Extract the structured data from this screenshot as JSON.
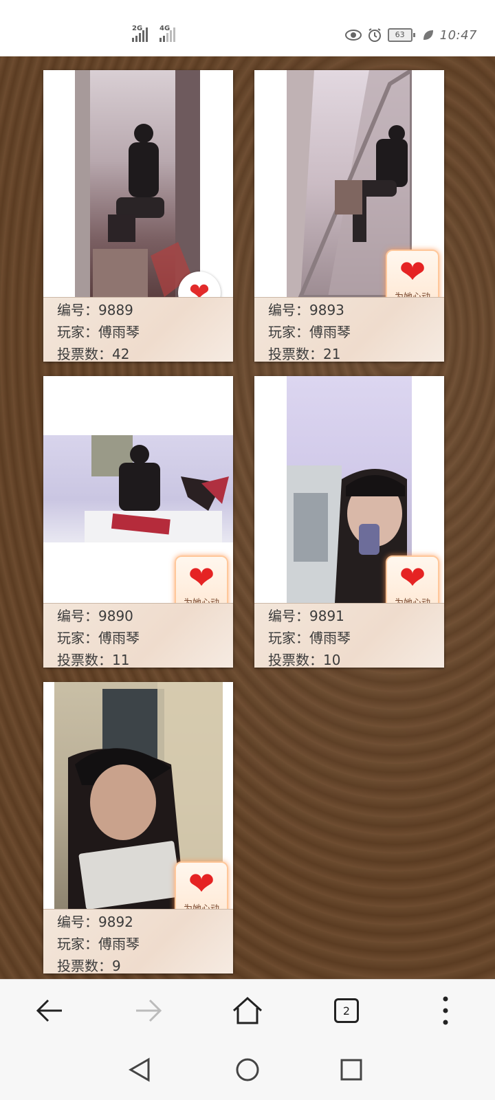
{
  "status_bar": {
    "network_1": "2G",
    "network_2": "4G",
    "battery": "63",
    "time": "10:47"
  },
  "cards": [
    {
      "number_label": "编号：",
      "number": "9889",
      "player_label": "玩家：",
      "player": "傅雨琴",
      "votes_label": "投票数：",
      "votes": "42",
      "vote_state": "voted"
    },
    {
      "number_label": "编号：",
      "number": "9893",
      "player_label": "玩家：",
      "player": "傅雨琴",
      "votes_label": "投票数：",
      "votes": "21",
      "vote_button_label": "为她心动"
    },
    {
      "number_label": "编号：",
      "number": "9890",
      "player_label": "玩家：",
      "player": "傅雨琴",
      "votes_label": "投票数：",
      "votes": "11",
      "vote_button_label": "为她心动"
    },
    {
      "number_label": "编号：",
      "number": "9891",
      "player_label": "玩家：",
      "player": "傅雨琴",
      "votes_label": "投票数：",
      "votes": "10",
      "vote_button_label": "为她心动"
    },
    {
      "number_label": "编号：",
      "number": "9892",
      "player_label": "玩家：",
      "player": "傅雨琴",
      "votes_label": "投票数：",
      "votes": "9",
      "vote_button_label": "为她心动"
    }
  ],
  "browser_nav": {
    "tab_count": "2"
  },
  "colors": {
    "heart": "#e22b2b",
    "card_info_bg": "#f1e2d6",
    "wood": "#5b3c22"
  }
}
